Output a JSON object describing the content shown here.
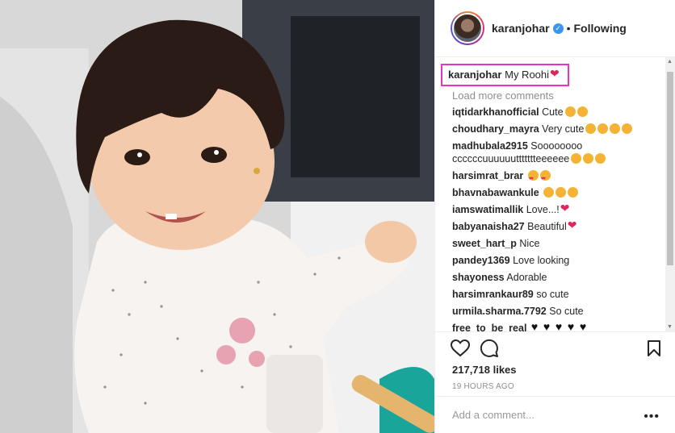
{
  "header": {
    "username": "karanjohar",
    "separator": "•",
    "follow_state": "Following"
  },
  "caption": {
    "username": "karanjohar",
    "text": "My Roohi"
  },
  "load_more": "Load more comments",
  "comments": [
    {
      "user": "iqtidarkhanofficial",
      "text": "Cute",
      "emoji": [
        "kiss",
        "kiss"
      ]
    },
    {
      "user": "choudhary_mayra",
      "text": "Very cute",
      "emoji": [
        "kiss",
        "kiss",
        "kiss",
        "kiss"
      ]
    },
    {
      "user": "madhubala2915",
      "text": "Soooooooo ccccccuuuuuuttttttteeeeee",
      "emoji": [
        "kiss",
        "kiss",
        "kiss"
      ]
    },
    {
      "user": "harsimrat_brar",
      "text": "",
      "emoji": [
        "heart-eyes",
        "heart-eyes"
      ]
    },
    {
      "user": "bhavnabawankule",
      "text": "",
      "emoji": [
        "kiss",
        "kiss",
        "kiss"
      ]
    },
    {
      "user": "iamswatimallik",
      "text": "Love...!",
      "emoji": [
        "hearts"
      ]
    },
    {
      "user": "babyanaisha27",
      "text": "Beautiful",
      "emoji": [
        "red-heart"
      ]
    },
    {
      "user": "sweet_hart_p",
      "text": "Nice",
      "emoji": []
    },
    {
      "user": "pandey1369",
      "text": "Love looking",
      "emoji": []
    },
    {
      "user": "shayoness",
      "text": "Adorable",
      "emoji": []
    },
    {
      "user": "harsimrankaur89",
      "text": "so cute",
      "emoji": []
    },
    {
      "user": "urmila.sharma.7792",
      "text": "So cute",
      "emoji": []
    },
    {
      "user": "free_to_be_real",
      "text": "",
      "emoji": [
        "black-heart",
        "black-heart",
        "black-heart",
        "black-heart",
        "black-heart"
      ]
    }
  ],
  "likes": "217,718 likes",
  "timestamp": "19 HOURS AGO",
  "add_comment": {
    "placeholder": "Add a comment..."
  },
  "more_menu": "•••",
  "icons": {
    "like": "heart-outline-icon",
    "comment": "speech-bubble-icon",
    "save": "bookmark-icon",
    "verified": "verified-badge-icon"
  },
  "colors": {
    "caption_highlight": "#e236c6",
    "verified": "#3897f0",
    "muted_text": "#8e8e8e"
  }
}
